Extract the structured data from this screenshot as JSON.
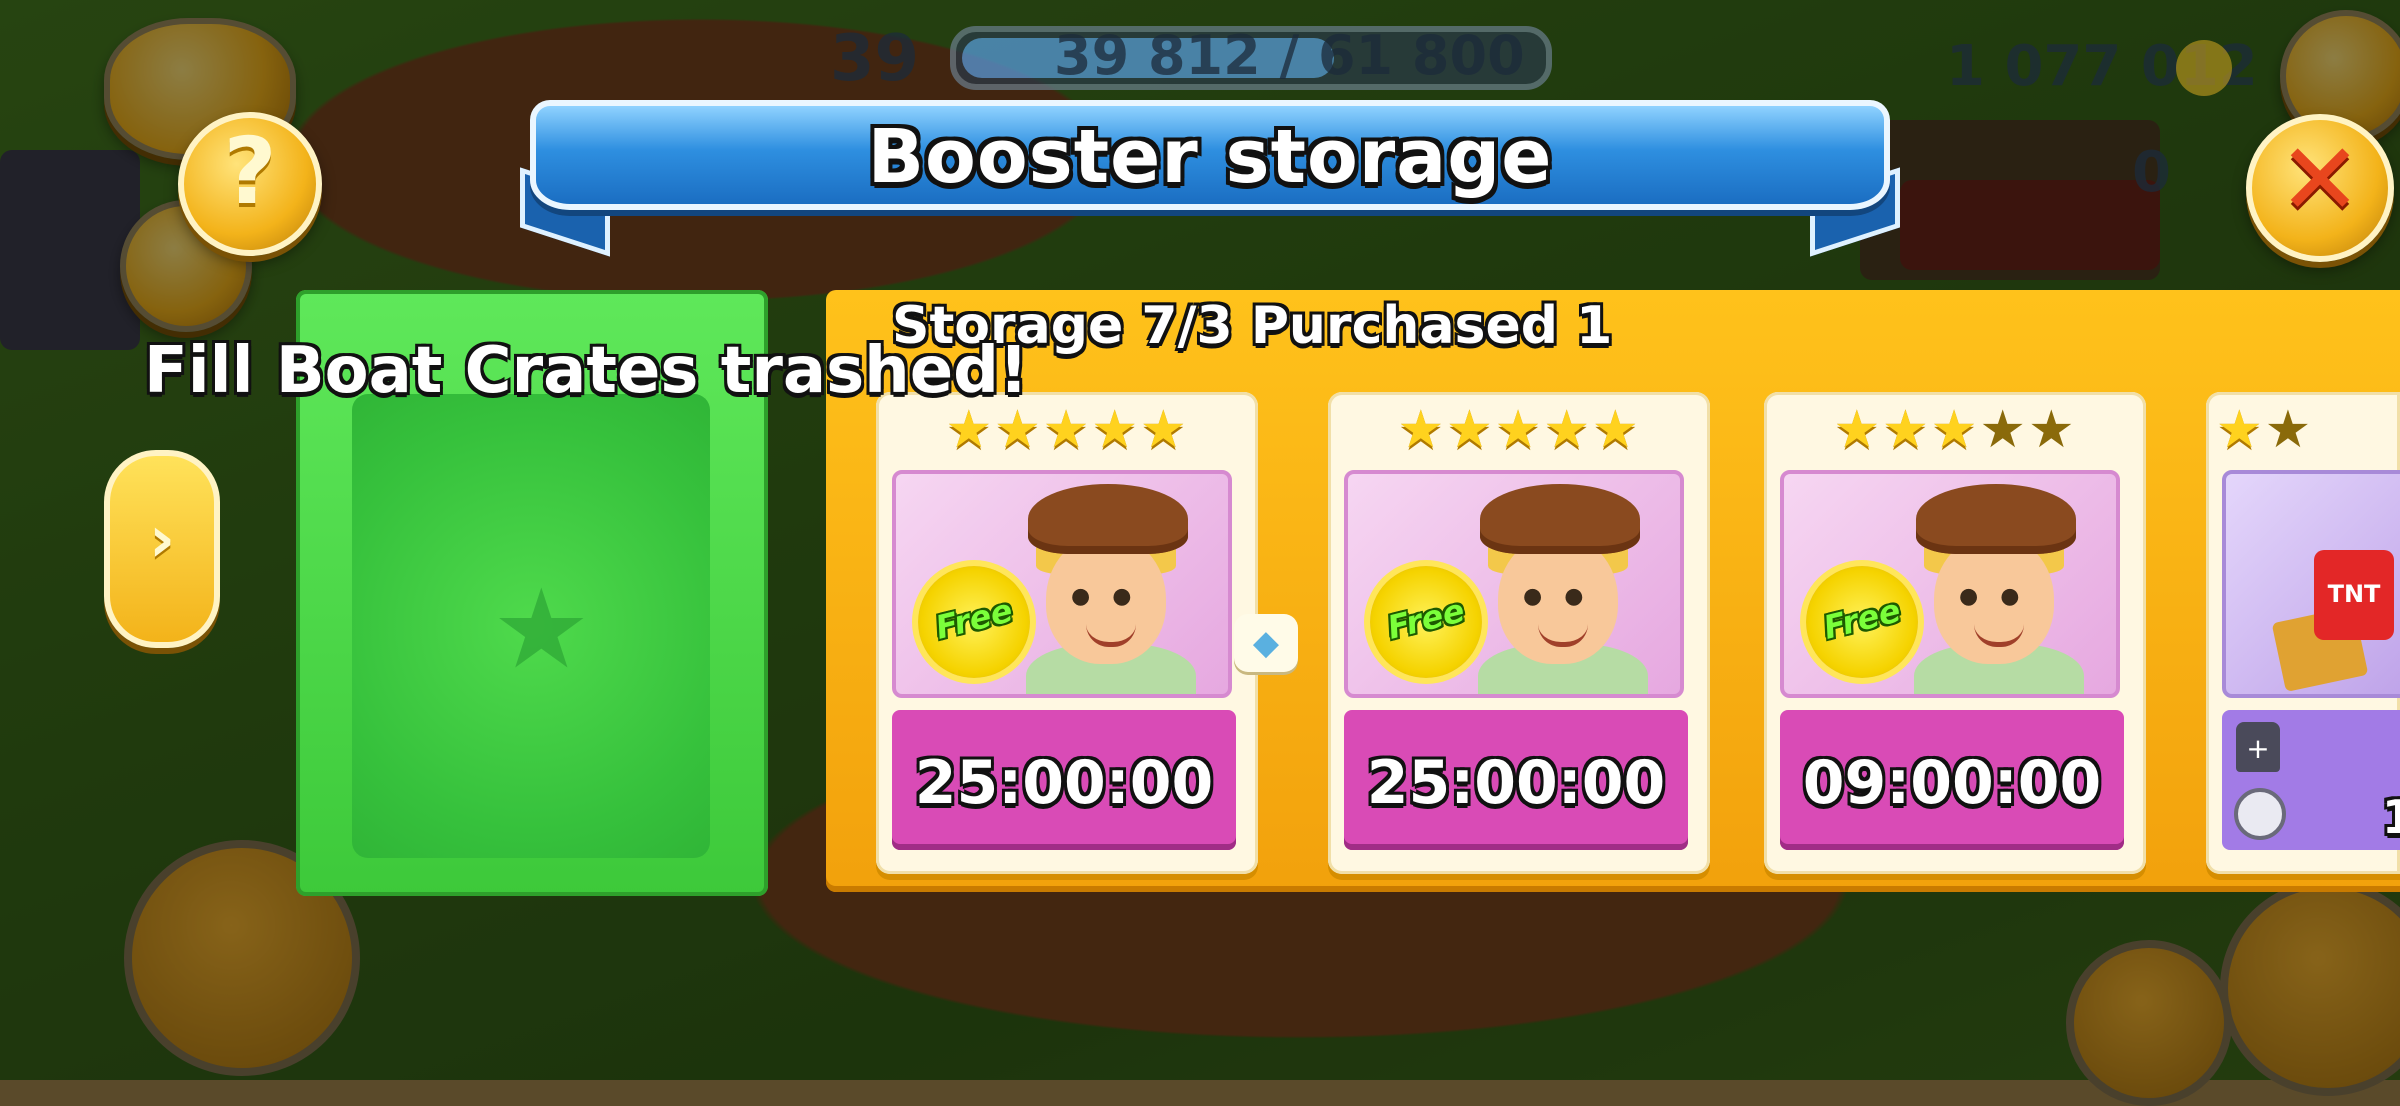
{
  "hud": {
    "level": "39",
    "xp_text": "39 812 / 61 800",
    "xp_progress": 0.644,
    "coins": "1 077 012",
    "diamonds": "0"
  },
  "dialog": {
    "title": "Booster storage",
    "storage_label": "Storage 7/3 Purchased 1",
    "trashed_message": "Fill Boat Crates trashed!"
  },
  "boosters": [
    {
      "stars": 5,
      "stars_max": 5,
      "free_label": "Free",
      "timer": "25:00:00",
      "has_diamond_button": true
    },
    {
      "stars": 5,
      "stars_max": 5,
      "free_label": "Free",
      "timer": "25:00:00",
      "has_diamond_button": false
    },
    {
      "stars": 3,
      "stars_max": 5,
      "free_label": "Free",
      "timer": "09:00:00",
      "has_diamond_button": false
    },
    {
      "stars": 1,
      "stars_max": 2,
      "free_label": "",
      "timer": "1",
      "has_diamond_button": false,
      "label": "TNT"
    }
  ],
  "icons": {
    "help": "question-icon",
    "close": "close-icon",
    "next": "chevron-right-icon",
    "mail": "mail-icon",
    "settings": "gear-icon",
    "shop": "cash-register-icon",
    "friends": "friends-icon",
    "diamond": "diamond-icon",
    "coin": "coin-icon",
    "add": "plus-icon"
  },
  "colors": {
    "banner": "#2e8fe0",
    "green_panel": "#4fe04a",
    "orange_panel": "#ffb514",
    "timer_bg": "#d94bb6",
    "close_x": "#e8461d"
  }
}
